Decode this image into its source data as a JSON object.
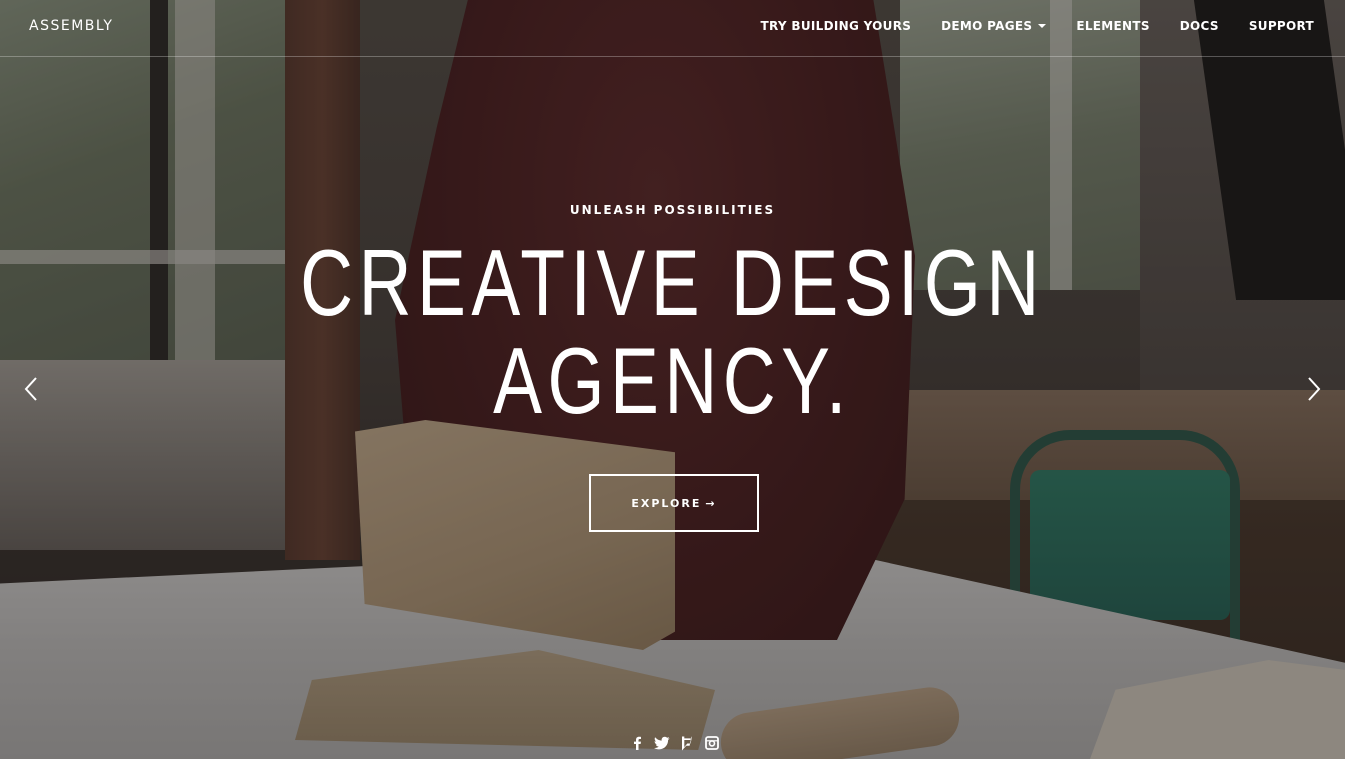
{
  "brand": {
    "logo_text": "ASSEMBLY"
  },
  "nav": {
    "items": [
      {
        "label": "TRY BUILDING YOURS",
        "has_dropdown": false
      },
      {
        "label": "DEMO PAGES",
        "has_dropdown": true
      },
      {
        "label": "ELEMENTS",
        "has_dropdown": false
      },
      {
        "label": "DOCS",
        "has_dropdown": false
      },
      {
        "label": "SUPPORT",
        "has_dropdown": false
      }
    ]
  },
  "hero": {
    "eyebrow": "UNLEASH POSSIBILITIES",
    "headline_line1": "CREATIVE DESIGN",
    "headline_line2": "AGENCY.",
    "cta_label": "EXPLORE",
    "cta_arrow": "→"
  },
  "slider": {
    "prev_icon": "chevron-left-icon",
    "next_icon": "chevron-right-icon"
  },
  "social": {
    "icons": [
      "facebook-icon",
      "twitter-icon",
      "foursquare-icon",
      "instagram-icon"
    ]
  },
  "colors": {
    "text": "#ffffff",
    "overlay": "#14100e"
  }
}
